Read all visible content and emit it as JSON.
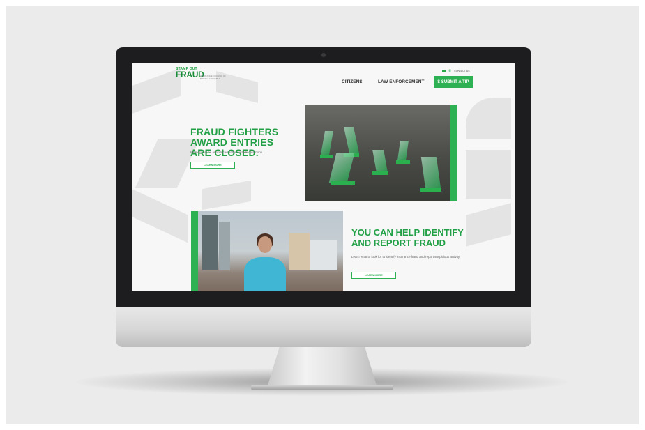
{
  "site": {
    "logo": {
      "top": "STAMP OUT",
      "main": "FRAUD",
      "tagline": "INSURANCE COUNCIL OF BRITISH COLUMBIA"
    },
    "nav": {
      "citizens": "CITIZENS",
      "law_enforcement": "LAW ENFORCEMENT"
    },
    "contact_label": "CONTACT US",
    "cta_button": "SUBMIT A TIP",
    "cta_icon": "$"
  },
  "hero": {
    "heading": "FRAUD FIGHTERS AWARD ENTRIES ARE CLOSED.",
    "subtext": "Winners will be announced at the awards ceremony.",
    "button_label": "LEARN MORE"
  },
  "section2": {
    "heading": "YOU CAN HELP IDENTIFY AND REPORT FRAUD",
    "subtext": "Learn what to look for to identify insurance fraud and report suspicious activity.",
    "button_label": "LEARN MORE"
  },
  "colors": {
    "brand_green": "#2db152",
    "bezel": "#1d1d1f"
  }
}
